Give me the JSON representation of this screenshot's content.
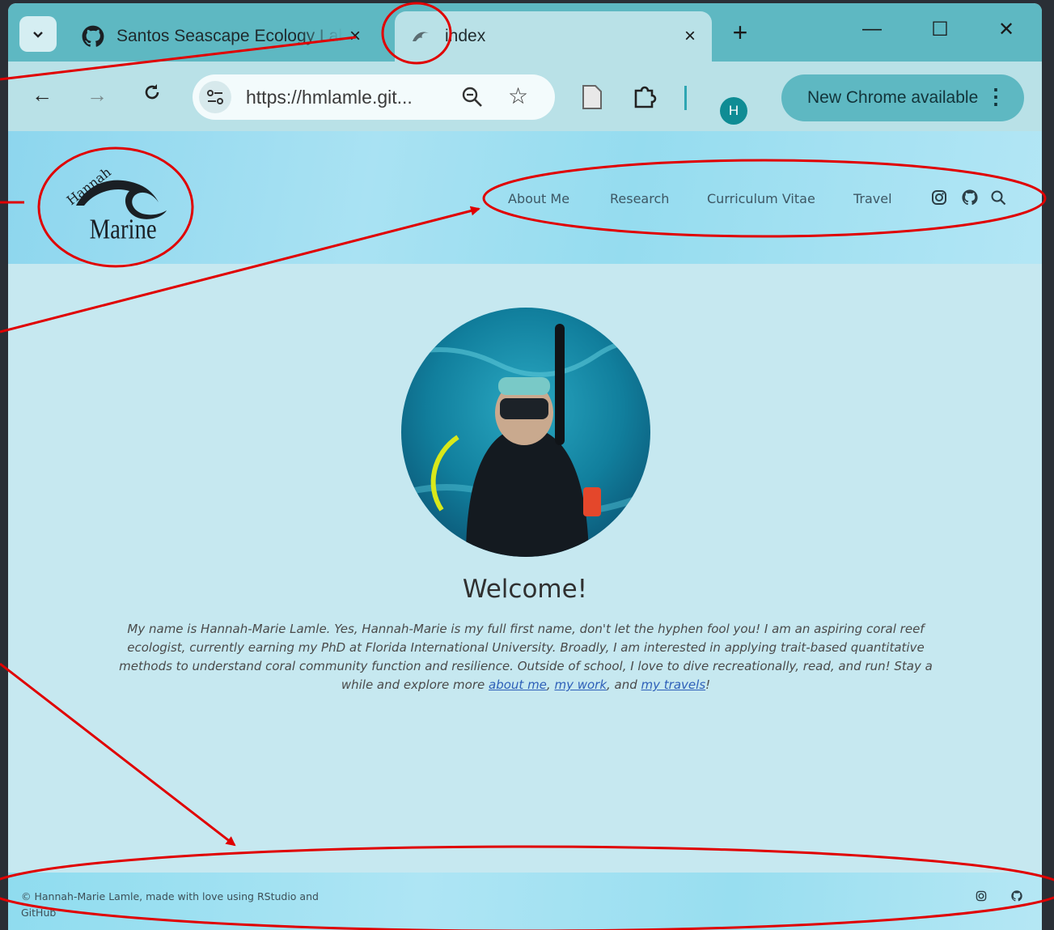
{
  "browser": {
    "tab_search_icon": "chevron-down-icon",
    "tabs": [
      {
        "title": "Santos Seascape Ecology Lab",
        "icon": "github-icon",
        "close": "×"
      },
      {
        "title": "index",
        "icon": "wave-logo-icon",
        "close": "×"
      }
    ],
    "new_tab": "+",
    "window_controls": {
      "minimize": "—",
      "maximize": "☐",
      "close": "✕"
    },
    "toolbar": {
      "back": "←",
      "forward": "→",
      "reload": "C",
      "url": "https://hmlamle.git...",
      "avatar_letter": "H",
      "update_label": "New Chrome available",
      "update_menu": "⋮"
    }
  },
  "site": {
    "logo_line1": "Hannah",
    "logo_line2": "Marine",
    "nav": [
      "About Me",
      "Research",
      "Curriculum Vitae",
      "Travel"
    ],
    "nav_icons": [
      "instagram-icon",
      "github-icon",
      "search-icon"
    ],
    "welcome": "Welcome!",
    "intro_text": "My name is Hannah-Marie Lamle. Yes, Hannah-Marie is my full first name, don't let the hyphen fool you! I am an aspiring coral reef ecologist, currently earning my PhD at Florida International University. Broadly, I am interested in applying trait-based quantitative methods to understand coral community function and resilience. Outside of school, I love to dive recreationally, read, and run! Stay a while and explore more ",
    "intro_links": [
      "about me",
      "my work",
      "my travels"
    ],
    "intro_sep1": ", ",
    "intro_sep2": ", and ",
    "intro_end": "!",
    "footer_text": "© Hannah-Marie Lamle, made with love using RStudio and GitHub",
    "footer_icons": [
      "instagram-icon",
      "github-icon"
    ]
  },
  "colors": {
    "annotation": "#e00000",
    "tab_strip": "#5eb8c2",
    "toolbar": "#b9e1e7",
    "page_bg": "#c6e8f0",
    "link": "#2d5fb8"
  }
}
